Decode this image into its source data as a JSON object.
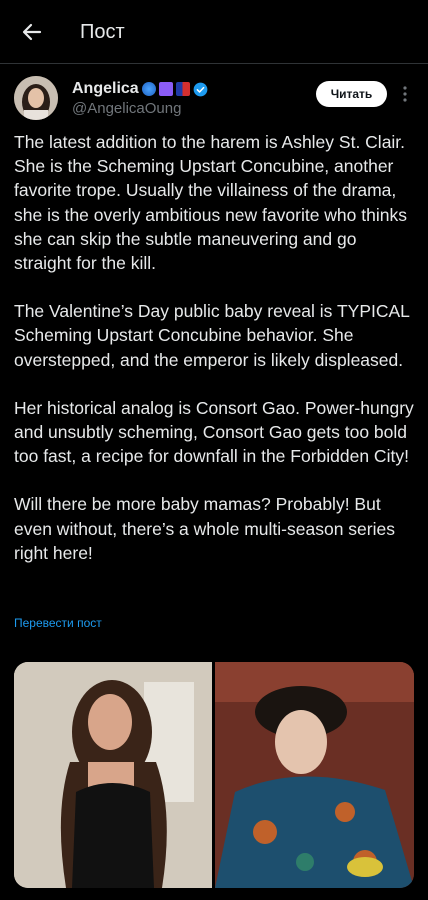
{
  "header": {
    "title": "Пост"
  },
  "author": {
    "name": "Angelica",
    "handle": "@AngelicaOung"
  },
  "follow_label": "Читать",
  "post": {
    "paragraphs": [
      "The latest addition to the harem is Ashley St. Clair. She is the Scheming Upstart Concubine, another favorite trope. Usually the villainess of the drama, she is the overly ambitious new favorite who thinks she can skip the subtle maneuvering and go straight for the kill.",
      "The Valentine’s Day public baby reveal is TYPICAL Scheming Upstart Concubine behavior. She overstepped, and the emperor is likely displeased.",
      "Her historical analog is Consort Gao. Power-hungry and unsubtly scheming, Consort Gao gets too bold too fast, a recipe for downfall in the Forbidden City!",
      "Will there be more baby mamas? Probably! But even without, there’s a whole multi-season series right here!"
    ]
  },
  "translate_label": "Перевести пост",
  "colors": {
    "link": "#1d9bf0",
    "verified": "#1d9bf0",
    "background": "#000000"
  }
}
